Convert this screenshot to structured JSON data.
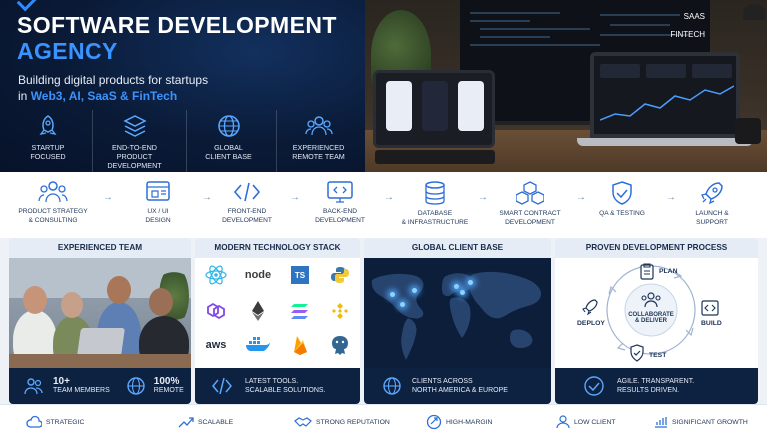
{
  "hero": {
    "title_line1": "SOFTWARE DEVELOPMENT",
    "title_line2": "AGENCY",
    "subtitle_line1": "Building digital products for startups",
    "subtitle_in": "in",
    "subtitle_highlight": "Web3, AI, SaaS & FinTech",
    "features": [
      {
        "icon": "rocket-icon",
        "label_1": "STARTUP",
        "label_2": "FOCUSED"
      },
      {
        "icon": "layers-icon",
        "label_1": "END-TO-END",
        "label_2": "PRODUCT DEVELOPMENT"
      },
      {
        "icon": "globe-icon",
        "label_1": "GLOBAL",
        "label_2": "CLIENT BASE"
      },
      {
        "icon": "team-icon",
        "label_1": "EXPERIENCED",
        "label_2": "REMOTE TEAM"
      }
    ]
  },
  "photo": {
    "tags": [
      "SAAS",
      "FINTECH"
    ]
  },
  "process": [
    {
      "icon": "strategy-icon",
      "label_1": "PRODUCT STRATEGY",
      "label_2": "& CONSULTING"
    },
    {
      "icon": "design-icon",
      "label_1": "UX / UI",
      "label_2": "DESIGN"
    },
    {
      "icon": "code-icon",
      "label_1": "FRONT-END",
      "label_2": "DEVELOPMENT"
    },
    {
      "icon": "monitor-code-icon",
      "label_1": "BACK-END",
      "label_2": "DEVELOPMENT"
    },
    {
      "icon": "database-icon",
      "label_1": "DATABASE",
      "label_2": "& INFRASTRUCTURE"
    },
    {
      "icon": "blocks-icon",
      "label_1": "SMART CONTRACT",
      "label_2": "DEVELOPMENT"
    },
    {
      "icon": "shield-check-icon",
      "label_1": "QA & TESTING",
      "label_2": ""
    },
    {
      "icon": "launch-rocket-icon",
      "label_1": "LAUNCH &",
      "label_2": "SUPPORT"
    }
  ],
  "panels": {
    "team": {
      "title": "EXPERIENCED TEAM",
      "stat1_value": "10+",
      "stat1_label": "TEAM MEMBERS",
      "stat2_value": "100%",
      "stat2_label": "REMOTE"
    },
    "tech": {
      "title": "MODERN TECHNOLOGY STACK",
      "logos": [
        "react",
        "node",
        "TS",
        "python",
        "polygon",
        "ethereum",
        "solana",
        "binance",
        "aws",
        "docker",
        "firebase",
        "postgres"
      ],
      "node_label": "node",
      "ts_label": "TS",
      "aws_label": "aws",
      "footer_1": "LATEST TOOLS.",
      "footer_2": "SCALABLE SOLUTIONS."
    },
    "global": {
      "title": "GLOBAL CLIENT BASE",
      "footer_1": "CLIENTS ACROSS",
      "footer_2": "NORTH AMERICA & EUROPE"
    },
    "process": {
      "title": "PROVEN DEVELOPMENT PROCESS",
      "plan": "PLAN",
      "build": "BUILD",
      "test": "TEST",
      "deploy": "DEPLOY",
      "center_1": "COLLABORATE",
      "center_2": "& DELIVER",
      "footer_1": "AGILE. TRANSPARENT.",
      "footer_2": "RESULTS DRIVEN."
    }
  },
  "strip": [
    "STRATEGIC",
    "SCALABLE",
    "STRONG REPUTATION",
    "HIGH-MARGIN",
    "LOW CLIENT",
    "SIGNIFICANT GROWTH"
  ],
  "colors": {
    "navy": "#0a1a36",
    "accent": "#3b93ff",
    "panel_footer": "#0d2140"
  }
}
